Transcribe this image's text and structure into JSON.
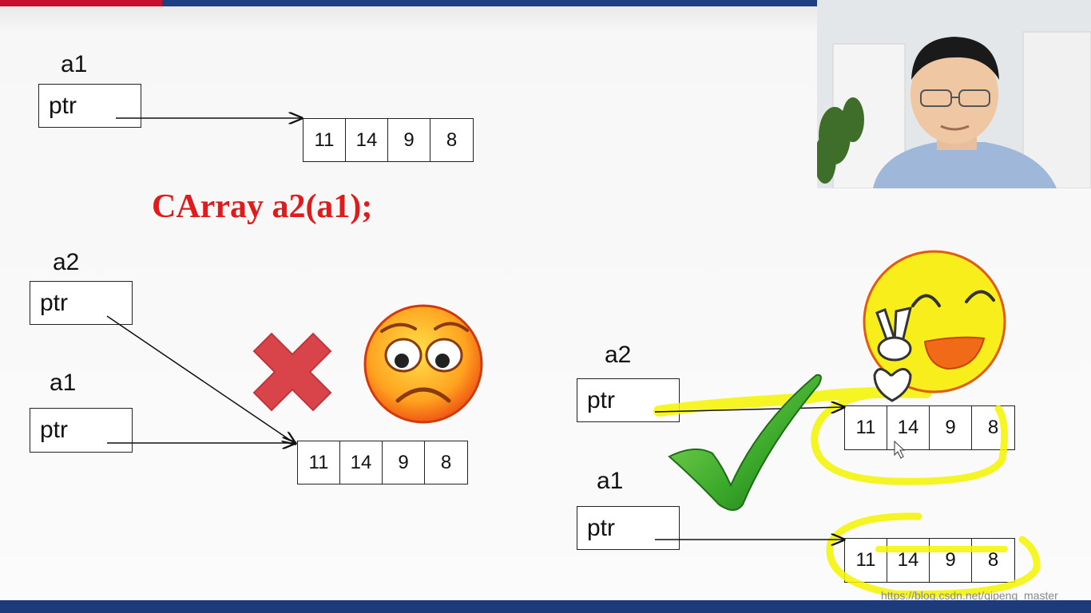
{
  "slide": {
    "code_line": "CArray a2(a1);",
    "url_watermark": "https://blog.csdn.net/qipeng_master",
    "colors": {
      "code_red": "#e01b1b",
      "highlight_yellow": "#f5f500",
      "check_green": "#3aa82a",
      "cross_red": "#d9434a"
    },
    "top_diagram": {
      "var_label": "a1",
      "ptr_label": "ptr",
      "array": [
        "11",
        "14",
        "9",
        "8"
      ]
    },
    "wrong_diagram": {
      "a2_label": "a2",
      "a2_ptr": "ptr",
      "a1_label": "a1",
      "a1_ptr": "ptr",
      "array": [
        "11",
        "14",
        "9",
        "8"
      ],
      "mark_icon": "cross-icon",
      "face_icon": "sad-face-icon"
    },
    "right_diagram": {
      "a2_label": "a2",
      "a2_ptr": "ptr",
      "a1_label": "a1",
      "a1_ptr": "ptr",
      "array_a2": [
        "11",
        "14",
        "9",
        "8"
      ],
      "array_a1": [
        "11",
        "14",
        "9",
        "8"
      ],
      "mark_icon": "checkmark-icon",
      "face_icon": "smiley-face-icon"
    }
  },
  "webcam": {
    "icon": "presenter-video-icon"
  }
}
